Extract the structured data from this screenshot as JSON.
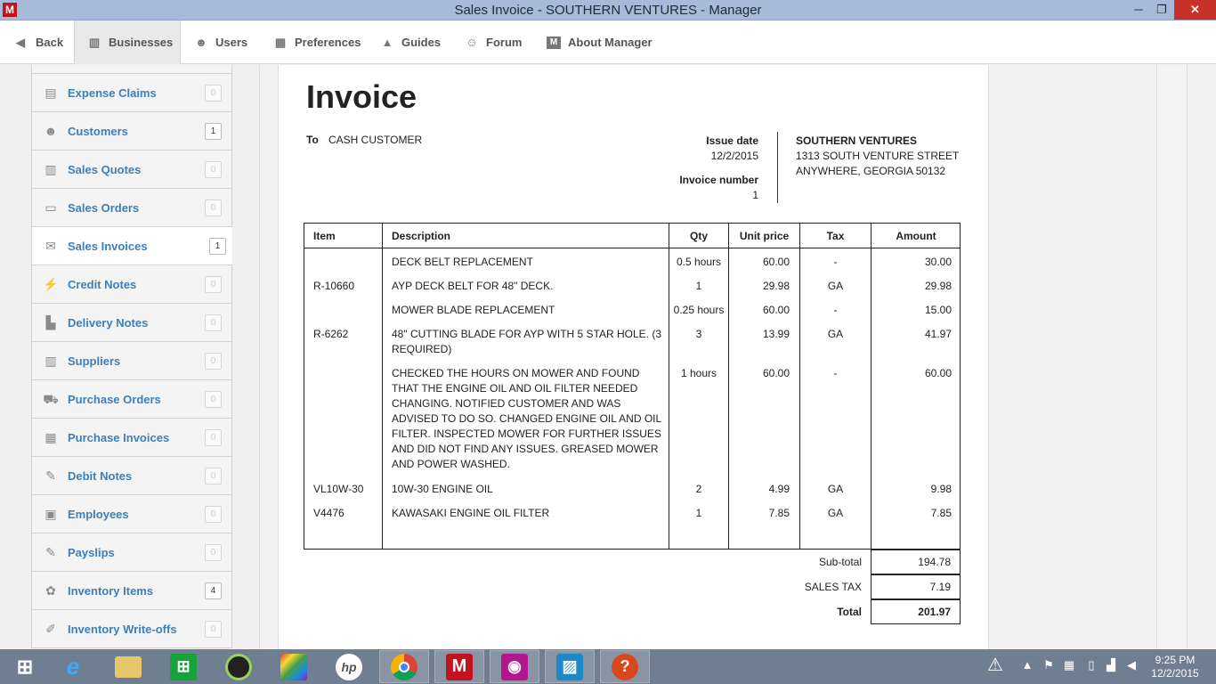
{
  "window": {
    "app_icon": "M",
    "title": "Sales Invoice - SOUTHERN VENTURES - Manager",
    "min_glyph": "─",
    "max_glyph": "❐",
    "close_glyph": "✕"
  },
  "toolbar": {
    "back": "Back",
    "businesses": "Businesses",
    "users": "Users",
    "preferences": "Preferences",
    "guides": "Guides",
    "forum": "Forum",
    "about": "About Manager"
  },
  "sidebar": {
    "items": [
      {
        "label": "Expense Claims",
        "count": "0",
        "icon": "expense-icon"
      },
      {
        "label": "Customers",
        "count": "1",
        "icon": "customers-icon"
      },
      {
        "label": "Sales Quotes",
        "count": "0",
        "icon": "quotes-icon"
      },
      {
        "label": "Sales Orders",
        "count": "0",
        "icon": "orders-icon"
      },
      {
        "label": "Sales Invoices",
        "count": "1",
        "icon": "invoices-icon"
      },
      {
        "label": "Credit Notes",
        "count": "0",
        "icon": "credit-icon"
      },
      {
        "label": "Delivery Notes",
        "count": "0",
        "icon": "delivery-icon"
      },
      {
        "label": "Suppliers",
        "count": "0",
        "icon": "suppliers-icon"
      },
      {
        "label": "Purchase Orders",
        "count": "0",
        "icon": "cart-icon"
      },
      {
        "label": "Purchase Invoices",
        "count": "0",
        "icon": "calendar-icon"
      },
      {
        "label": "Debit Notes",
        "count": "0",
        "icon": "debit-icon"
      },
      {
        "label": "Employees",
        "count": "0",
        "icon": "employees-icon"
      },
      {
        "label": "Payslips",
        "count": "0",
        "icon": "payslips-icon"
      },
      {
        "label": "Inventory Items",
        "count": "4",
        "icon": "inventory-icon"
      },
      {
        "label": "Inventory Write-offs",
        "count": "0",
        "icon": "writeoff-icon"
      }
    ]
  },
  "invoice": {
    "title": "Invoice",
    "to_label": "To",
    "to_value": "CASH CUSTOMER",
    "issue_date_label": "Issue date",
    "issue_date": "12/2/2015",
    "invoice_number_label": "Invoice number",
    "invoice_number": "1",
    "business": {
      "name": "SOUTHERN VENTURES",
      "address1": "1313 SOUTH VENTURE STREET",
      "address2": "ANYWHERE, GEORGIA 50132"
    },
    "columns": {
      "item": "Item",
      "description": "Description",
      "qty": "Qty",
      "unit_price": "Unit price",
      "tax": "Tax",
      "amount": "Amount"
    },
    "lines": [
      {
        "item": "",
        "description": "DECK BELT REPLACEMENT",
        "qty": "0.5 hours",
        "unit_price": "60.00",
        "tax": "-",
        "amount": "30.00"
      },
      {
        "item": "R-10660",
        "description": "AYP DECK BELT FOR 48\" DECK.",
        "qty": "1",
        "unit_price": "29.98",
        "tax": "GA",
        "amount": "29.98"
      },
      {
        "item": "",
        "description": "MOWER BLADE REPLACEMENT",
        "qty": "0.25 hours",
        "unit_price": "60.00",
        "tax": "-",
        "amount": "15.00"
      },
      {
        "item": "R-6262",
        "description": "48\" CUTTING BLADE FOR AYP WITH 5 STAR HOLE. (3 REQUIRED)",
        "qty": "3",
        "unit_price": "13.99",
        "tax": "GA",
        "amount": "41.97"
      },
      {
        "item": "",
        "description": "CHECKED THE HOURS ON MOWER AND FOUND THAT THE ENGINE OIL AND OIL FILTER NEEDED CHANGING. NOTIFIED CUSTOMER AND WAS ADVISED TO DO SO. CHANGED ENGINE OIL AND OIL FILTER. INSPECTED MOWER FOR FURTHER ISSUES AND DID NOT FIND ANY ISSUES. GREASED MOWER AND POWER WASHED.",
        "qty": "1 hours",
        "unit_price": "60.00",
        "tax": "-",
        "amount": "60.00"
      },
      {
        "item": "VL10W-30",
        "description": "10W-30 ENGINE OIL",
        "qty": "2",
        "unit_price": "4.99",
        "tax": "GA",
        "amount": "9.98"
      },
      {
        "item": "V4476",
        "description": "KAWASAKI ENGINE OIL FILTER",
        "qty": "1",
        "unit_price": "7.85",
        "tax": "GA",
        "amount": "7.85"
      }
    ],
    "totals": {
      "subtotal_label": "Sub-total",
      "subtotal": "194.78",
      "tax_label": "SALES TAX",
      "tax": "7.19",
      "total_label": "Total",
      "total": "201.97"
    }
  },
  "taskbar": {
    "clock_time": "9:25 PM",
    "clock_date": "12/2/2015",
    "apps": [
      "windows-start",
      "internet-explorer",
      "file-explorer",
      "windows-store",
      "webcam-app",
      "paint-app",
      "hp-app",
      "chrome",
      "manager",
      "camera-app",
      "photos-app",
      "help-app"
    ]
  }
}
